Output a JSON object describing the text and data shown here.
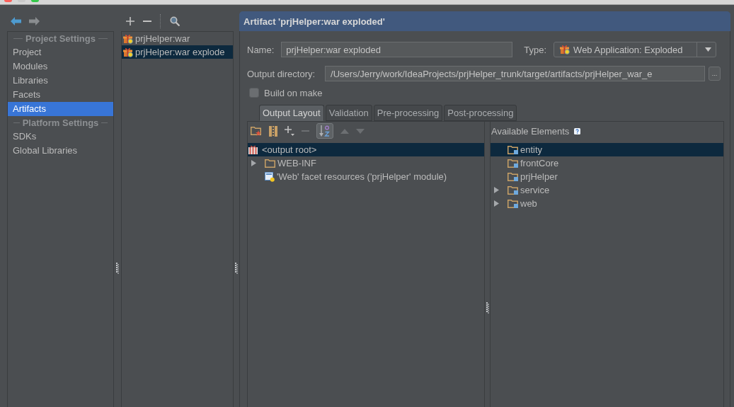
{
  "navigation": [
    {
      "kind": "back",
      "disabled": false
    },
    {
      "kind": "forward",
      "disabled": true
    }
  ],
  "sidebar": {
    "sections": [
      {
        "heading": "Project Settings",
        "items": [
          {
            "label": "Project",
            "selected": false
          },
          {
            "label": "Modules",
            "selected": false
          },
          {
            "label": "Libraries",
            "selected": false
          },
          {
            "label": "Facets",
            "selected": false
          },
          {
            "label": "Artifacts",
            "selected": true
          }
        ]
      },
      {
        "heading": "Platform Settings",
        "items": [
          {
            "label": "SDKs",
            "selected": false
          },
          {
            "label": "Global Libraries",
            "selected": false
          }
        ]
      }
    ]
  },
  "artifact_list": [
    {
      "label": "prjHelper:war",
      "selected": false
    },
    {
      "label": "prjHelper:war explode",
      "selected": true
    }
  ],
  "artifact": {
    "title": "Artifact 'prjHelper:war exploded'",
    "name": {
      "label": "Name:",
      "value": "prjHelper:war exploded"
    },
    "type": {
      "label": "Type:",
      "value": "Web Application: Exploded"
    },
    "output_directory": {
      "label": "Output directory:",
      "value": "/Users/Jerry/work/IdeaProjects/prjHelper_trunk/target/artifacts/prjHelper_war_e",
      "browse": "..."
    },
    "build_on_make": {
      "label": "Build on make",
      "checked": false
    },
    "tabs": [
      {
        "label": "Output Layout",
        "selected": true
      },
      {
        "label": "Validation",
        "selected": false
      },
      {
        "label": "Pre-processing",
        "selected": false
      },
      {
        "label": "Post-processing",
        "selected": false
      }
    ],
    "layout_toolbar": [
      {
        "kind": "new-directory",
        "disabled": false
      },
      {
        "kind": "archive",
        "disabled": false
      },
      {
        "kind": "add",
        "disabled": false
      },
      {
        "kind": "remove",
        "disabled": true
      },
      {
        "kind": "sort",
        "on": true
      },
      {
        "kind": "move-up",
        "disabled": true
      },
      {
        "kind": "move-down",
        "disabled": true
      }
    ],
    "layout_tree": [
      {
        "label": "<output root>",
        "kind": "archive-root",
        "selected": true,
        "children": [
          {
            "label": "WEB-INF",
            "kind": "folder",
            "selected": false,
            "expanded": false
          },
          {
            "label": "'Web' facet resources ('prjHelper' module)",
            "kind": "facet",
            "selected": false
          }
        ]
      }
    ],
    "available_elements": {
      "heading": "Available Elements",
      "items": [
        {
          "label": "entity",
          "selected": true
        },
        {
          "label": "frontCore",
          "selected": false
        },
        {
          "label": "prjHelper",
          "selected": false
        },
        {
          "label": "service",
          "selected": false,
          "expanded": false
        },
        {
          "label": "web",
          "selected": false,
          "expanded": false
        }
      ]
    }
  }
}
